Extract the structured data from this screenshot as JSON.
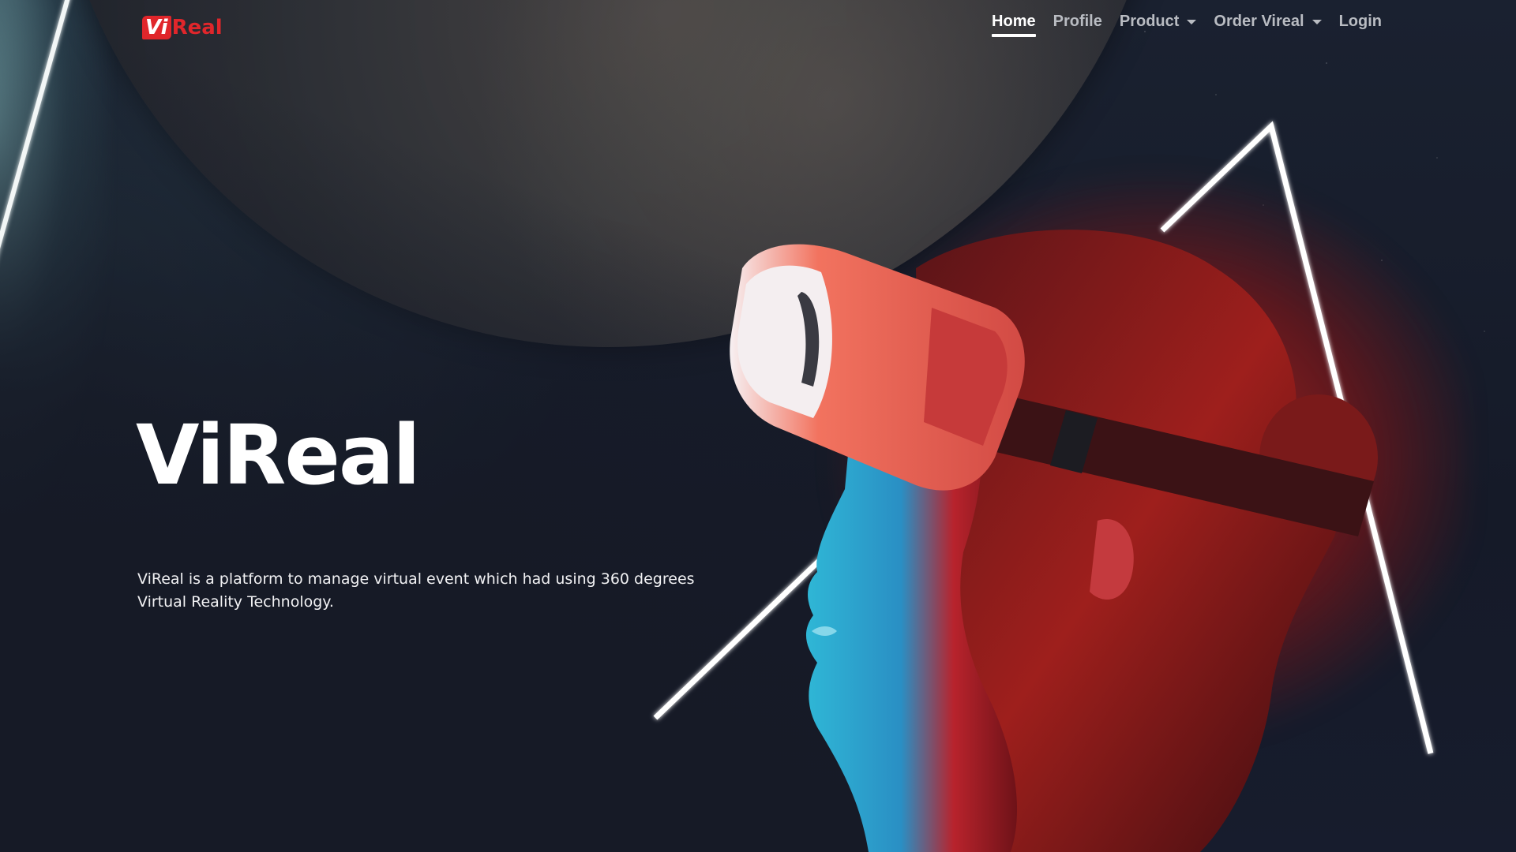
{
  "brand": {
    "logo_vi": "Vi",
    "logo_real": "Real",
    "color": "#e0262b"
  },
  "nav": {
    "items": [
      {
        "label": "Home",
        "active": true,
        "dropdown": false
      },
      {
        "label": "Profile",
        "active": false,
        "dropdown": false
      },
      {
        "label": "Product",
        "active": false,
        "dropdown": true
      },
      {
        "label": "Order Vireal",
        "active": false,
        "dropdown": true
      },
      {
        "label": "Login",
        "active": false,
        "dropdown": false
      }
    ]
  },
  "hero": {
    "title": "ViReal",
    "description": "ViReal is a platform to manage virtual event which had using 360 degrees Virtual Reality Technology."
  },
  "colors": {
    "background": "#161b2b",
    "accent_red": "#e0262b",
    "nav_text": "#b9bcc2",
    "nav_active": "#ffffff"
  },
  "icons": {
    "dropdown": "caret-down-icon"
  }
}
